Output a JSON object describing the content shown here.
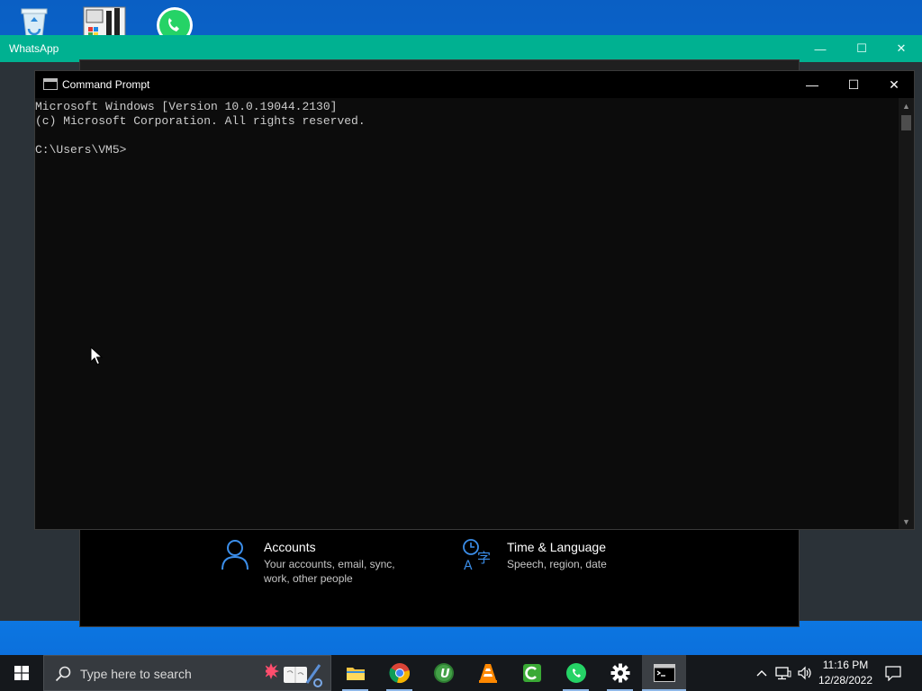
{
  "desktop": {
    "icons": [
      "recycle-bin-icon",
      "control-panel-icon",
      "whatsapp-icon"
    ]
  },
  "whatsapp_window": {
    "title": "WhatsApp",
    "accent": "#00b191",
    "controls": {
      "minimize": "—",
      "maximize": "☐",
      "close": "✕"
    }
  },
  "settings_window": {
    "tiles": [
      {
        "icon": "person-icon",
        "title": "Accounts",
        "desc": "Your accounts, email, sync, work, other people"
      },
      {
        "icon": "time-language-icon",
        "title": "Time & Language",
        "desc": "Speech, region, date"
      }
    ],
    "accent": "#3b8eea"
  },
  "cmd_window": {
    "title": "Command Prompt",
    "controls": {
      "minimize": "—",
      "maximize": "☐",
      "close": "✕"
    },
    "lines": [
      "Microsoft Windows [Version 10.0.19044.2130]",
      "(c) Microsoft Corporation. All rights reserved.",
      "",
      "C:\\Users\\VM5>"
    ],
    "text_color": "#cccccc",
    "scroll": {
      "up": "▲",
      "down": "▼"
    }
  },
  "taskbar": {
    "search_placeholder": "Type here to search",
    "apps": [
      {
        "name": "file-explorer",
        "active": false
      },
      {
        "name": "chrome",
        "active": false
      },
      {
        "name": "ultraviewer",
        "active": false
      },
      {
        "name": "vlc",
        "active": false
      },
      {
        "name": "camtasia",
        "active": false
      },
      {
        "name": "whatsapp",
        "active": false
      },
      {
        "name": "settings",
        "active": false
      },
      {
        "name": "command-prompt",
        "active": true
      }
    ],
    "tray": {
      "chevron": "^",
      "network": "network-icon",
      "volume": "volume-icon",
      "notifications": "notification-icon"
    },
    "clock": {
      "time": "11:16 PM",
      "date": "12/28/2022"
    }
  }
}
